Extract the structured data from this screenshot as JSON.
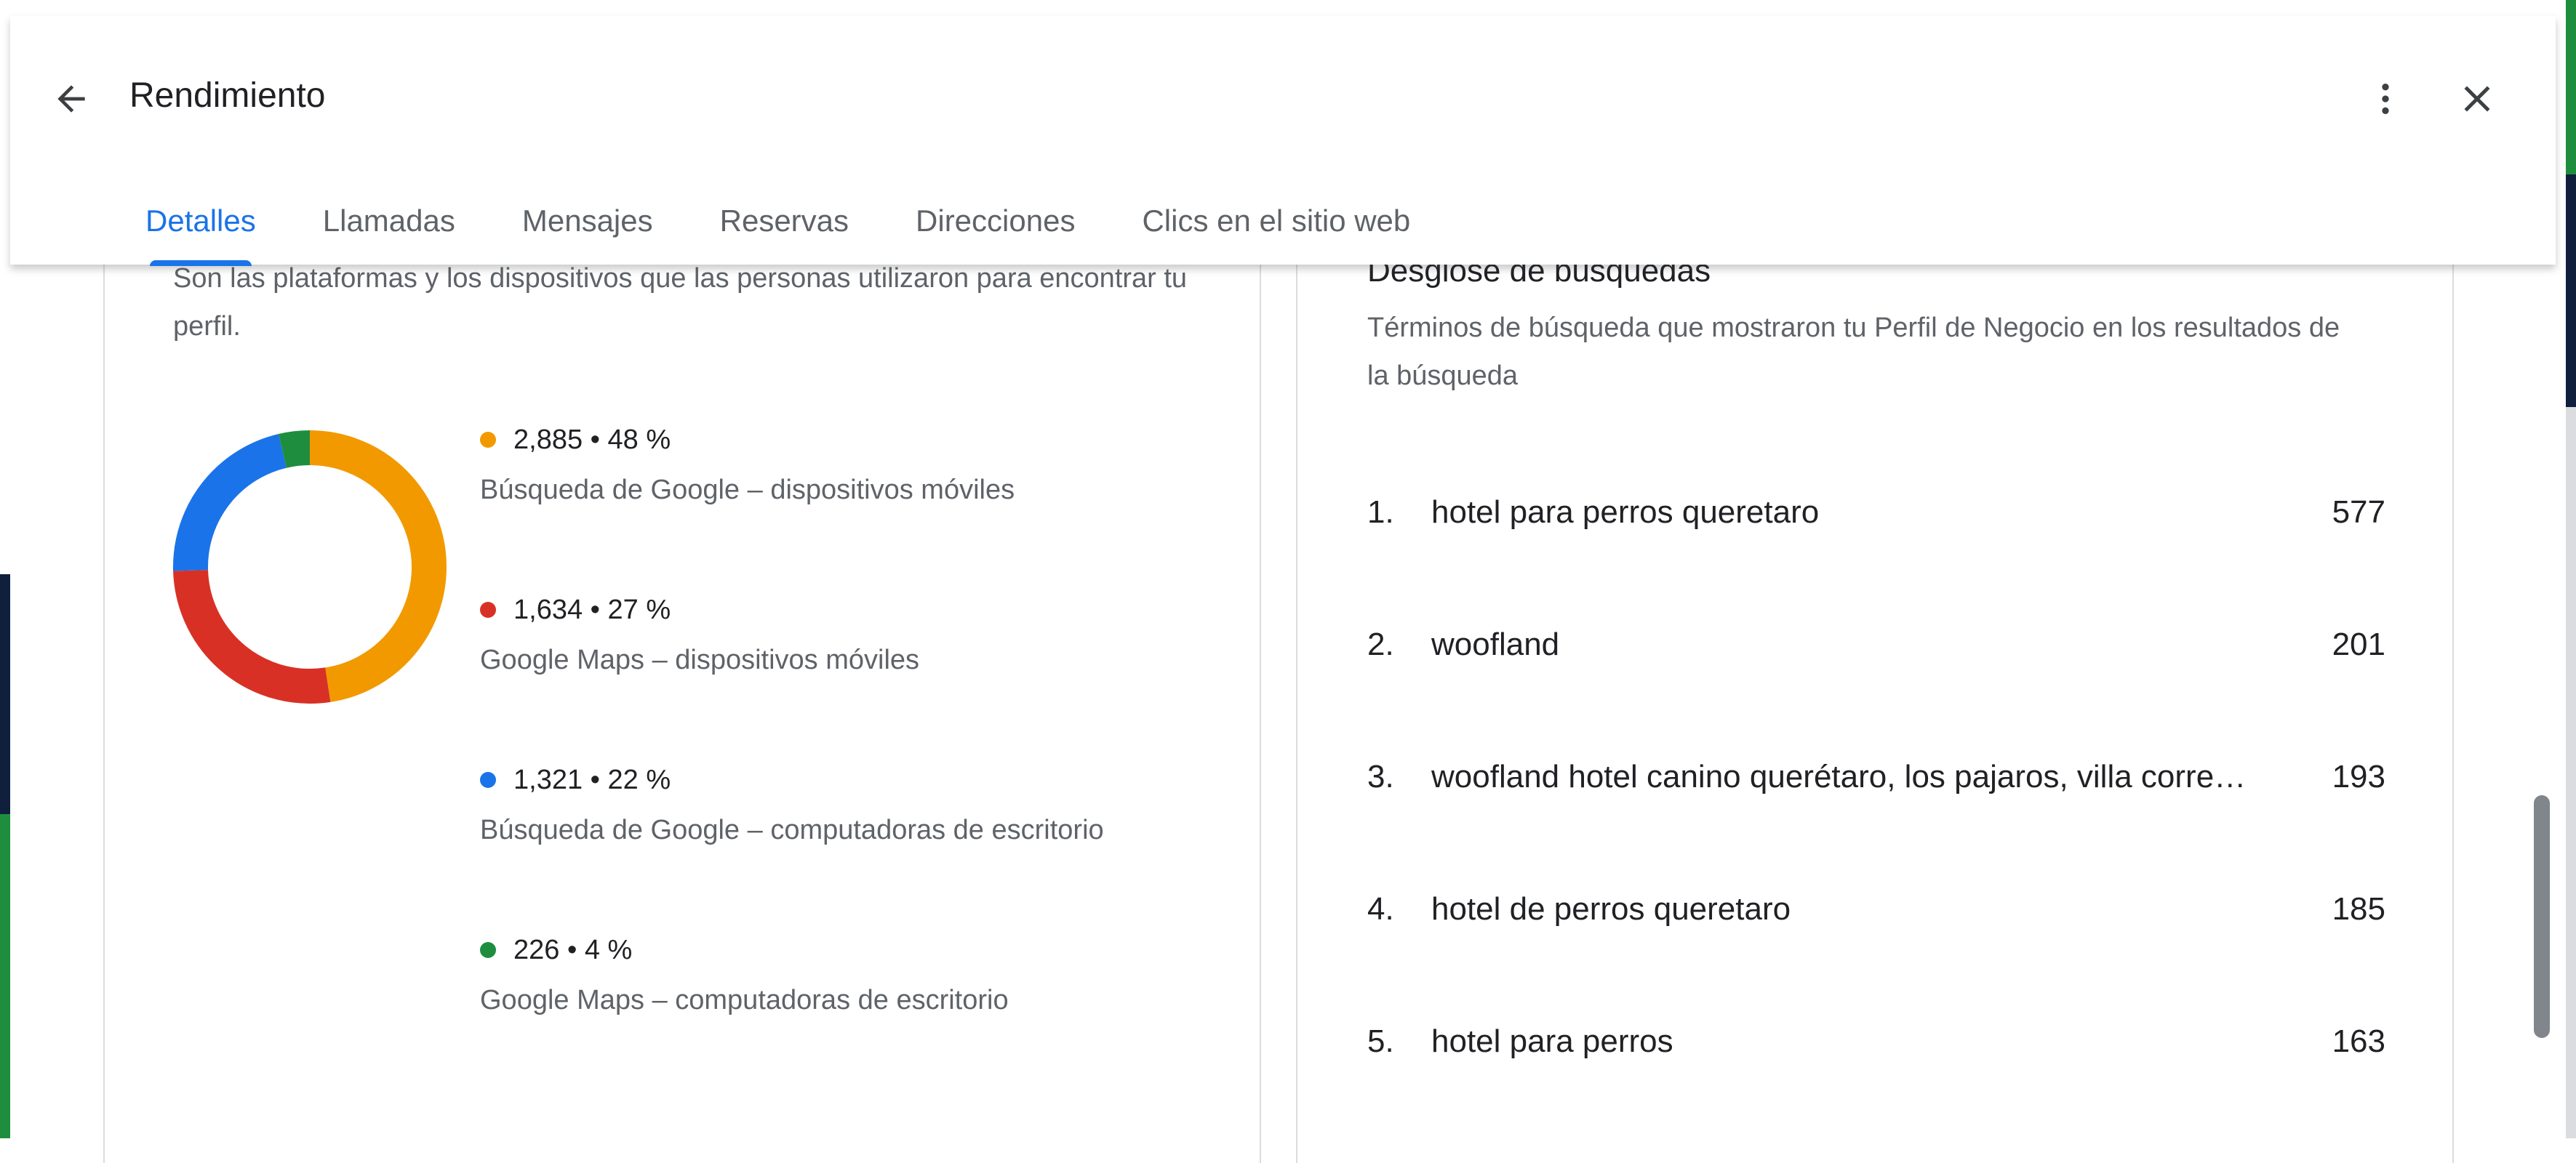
{
  "header": {
    "title": "Rendimiento",
    "back_icon": "arrow-back-icon",
    "more_icon": "more-vert-icon",
    "close_icon": "close-icon",
    "tabs": [
      {
        "label": "Detalles",
        "active": true
      },
      {
        "label": "Llamadas",
        "active": false
      },
      {
        "label": "Mensajes",
        "active": false
      },
      {
        "label": "Reservas",
        "active": false
      },
      {
        "label": "Direcciones",
        "active": false
      },
      {
        "label": "Clics en el sitio web",
        "active": false
      }
    ]
  },
  "platforms": {
    "description": "Son las plataformas y los dispositivos que las personas utilizaron para encontrar tu perfil.",
    "items": [
      {
        "value": "2,885 • 48 %",
        "count": 2885,
        "percent": 48,
        "label": "Búsqueda de Google – dispositivos móviles",
        "color": "#f29900"
      },
      {
        "value": "1,634 • 27 %",
        "count": 1634,
        "percent": 27,
        "label": "Google Maps – dispositivos móviles",
        "color": "#d93025"
      },
      {
        "value": "1,321 • 22 %",
        "count": 1321,
        "percent": 22,
        "label": "Búsqueda de Google – computadoras de escritorio",
        "color": "#1a73e8"
      },
      {
        "value": "226 • 4 %",
        "count": 226,
        "percent": 4,
        "label": "Google Maps – computadoras de escritorio",
        "color": "#1e8e3e"
      }
    ]
  },
  "searches": {
    "title": "Desglose de búsquedas",
    "description": "Términos de búsqueda que mostraron tu Perfil de Negocio en los resultados de la búsqueda",
    "terms": [
      {
        "rank": "1.",
        "term": "hotel para perros queretaro",
        "count": "577"
      },
      {
        "rank": "2.",
        "term": "woofland",
        "count": "201"
      },
      {
        "rank": "3.",
        "term": "woofland hotel canino querétaro, los pajaros, villa corregidora",
        "count": "193"
      },
      {
        "rank": "4.",
        "term": "hotel de perros queretaro",
        "count": "185"
      },
      {
        "rank": "5.",
        "term": "hotel para perros",
        "count": "163"
      }
    ]
  },
  "colors": {
    "accent": "#1a73e8",
    "orange": "#f29900",
    "red": "#d93025",
    "blue": "#1a73e8",
    "green": "#1e8e3e"
  }
}
